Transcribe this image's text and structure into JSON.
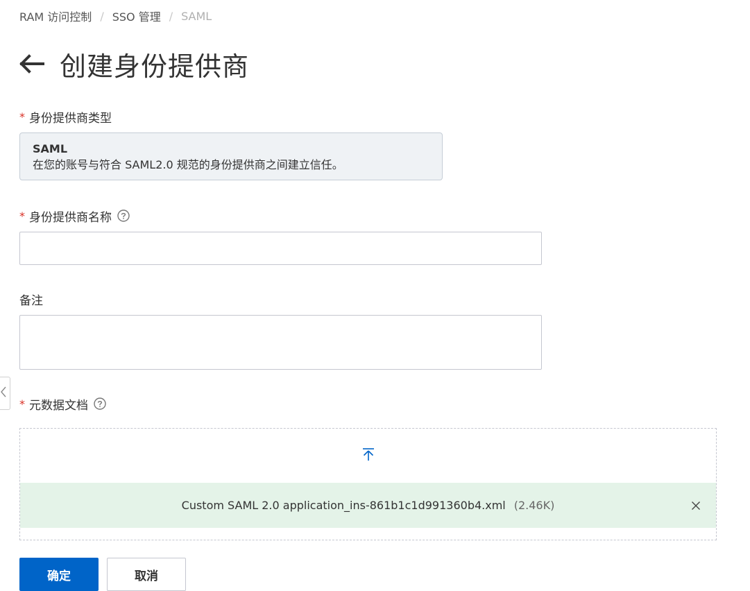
{
  "breadcrumb": {
    "items": [
      "RAM 访问控制",
      "SSO 管理",
      "SAML"
    ],
    "separator": "/"
  },
  "page": {
    "title": "创建身份提供商",
    "back_icon": "arrow-left-icon"
  },
  "form": {
    "provider_type": {
      "label": "身份提供商类型",
      "required": "*",
      "selected_name": "SAML",
      "selected_desc": "在您的账号与符合 SAML2.0 规范的身份提供商之间建立信任。"
    },
    "provider_name": {
      "label": "身份提供商名称",
      "required": "*",
      "help_icon": "question-circle-icon",
      "value": ""
    },
    "remark": {
      "label": "备注",
      "value": ""
    },
    "metadata": {
      "label": "元数据文档",
      "required": "*",
      "help_icon": "question-circle-icon",
      "upload_icon": "upload-icon",
      "file_name": "Custom SAML 2.0 application_ins-861b1c1d991360b4.xml",
      "file_size": "(2.46K)",
      "remove_icon": "close-icon"
    }
  },
  "actions": {
    "confirm": "确定",
    "cancel": "取消"
  },
  "colors": {
    "primary": "#0064c8",
    "required": "#d93026",
    "file_bg": "#e4f3e8",
    "card_bg": "#eff2f5"
  }
}
